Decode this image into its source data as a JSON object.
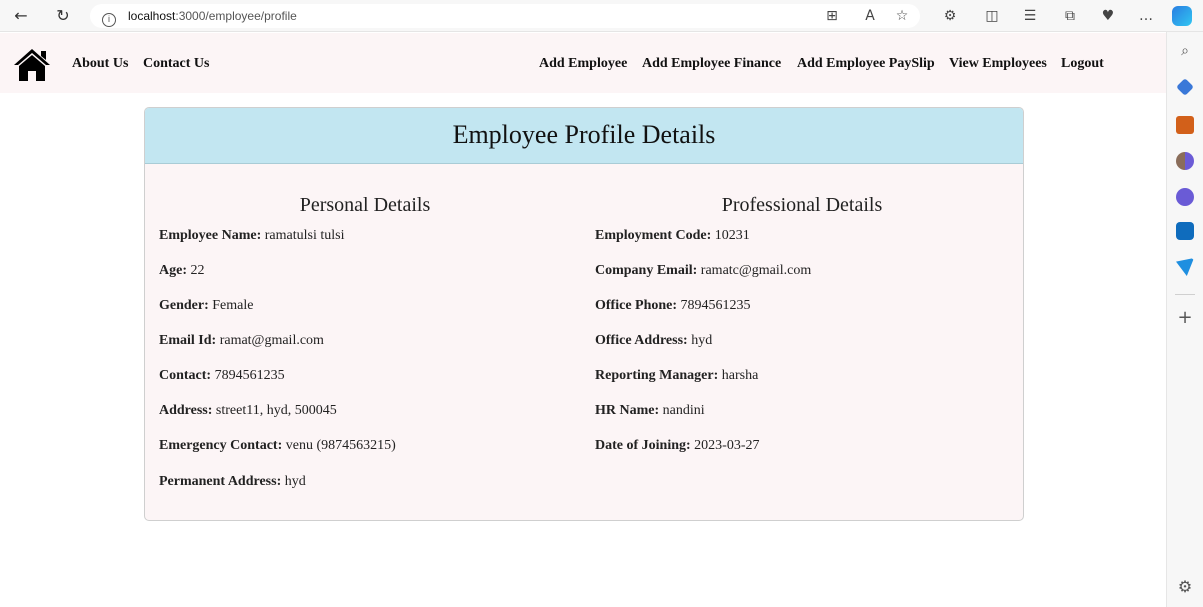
{
  "browser": {
    "url_host": "localhost",
    "url_path": ":3000/employee/profile"
  },
  "navbar": {
    "left_links": [
      "About Us",
      "Contact Us"
    ],
    "right_links": [
      "Add Employee",
      "Add Employee Finance",
      "Add Employee PaySlip",
      "View Employees",
      "Logout"
    ]
  },
  "card": {
    "title": "Employee Profile Details",
    "personal": {
      "heading": "Personal Details",
      "fields": [
        {
          "label": "Employee Name:",
          "value": "ramatulsi tulsi"
        },
        {
          "label": "Age:",
          "value": "22"
        },
        {
          "label": "Gender:",
          "value": "Female"
        },
        {
          "label": "Email Id:",
          "value": "ramat@gmail.com"
        },
        {
          "label": "Contact:",
          "value": "7894561235"
        },
        {
          "label": "Address:",
          "value": "street11, hyd, 500045"
        },
        {
          "label": "Emergency Contact:",
          "value": "venu (9874563215)"
        },
        {
          "label": "Permanent Address:",
          "value": "hyd"
        }
      ]
    },
    "professional": {
      "heading": "Professional Details",
      "fields": [
        {
          "label": "Employment Code:",
          "value": "10231"
        },
        {
          "label": "Company Email:",
          "value": "ramatc@gmail.com"
        },
        {
          "label": "Office Phone:",
          "value": "7894561235"
        },
        {
          "label": "Office Address:",
          "value": "hyd"
        },
        {
          "label": "Reporting Manager:",
          "value": "harsha"
        },
        {
          "label": "HR Name:",
          "value": "nandini"
        },
        {
          "label": "Date of Joining:",
          "value": "2023-03-27"
        }
      ]
    }
  },
  "colors": {
    "navbar_bg": "#fcf5f6",
    "card_header_bg": "#c2e6f1",
    "card_bg": "#fcf5f6"
  }
}
